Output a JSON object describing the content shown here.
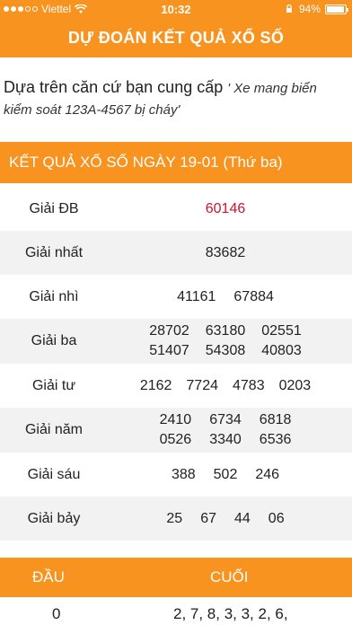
{
  "status_bar": {
    "carrier": "Viettel",
    "time": "10:32",
    "battery_text": "94%",
    "battery_level": 0.94
  },
  "nav": {
    "title": "DỰ ĐOÁN KẾT QUẢ XỔ SỐ"
  },
  "intro": {
    "text": "Dựa trên căn cứ bạn cung cấp",
    "quote": "' Xe mang biển kiểm soát 123A-4567 bị cháy'"
  },
  "result_header": {
    "title": "KẾT QUẢ XỔ SỐ NGÀY 19-01 (Thứ ba)"
  },
  "prizes": [
    {
      "name": "Giải ĐB",
      "lines": [
        [
          "60146"
        ]
      ]
    },
    {
      "name": "Giải nhất",
      "lines": [
        [
          "83682"
        ]
      ]
    },
    {
      "name": "Giải nhì",
      "lines": [
        [
          "41161",
          "67884"
        ]
      ]
    },
    {
      "name": "Giải ba",
      "lines": [
        [
          "28702",
          "63180",
          "02551"
        ],
        [
          "51407",
          "54308",
          "40803"
        ]
      ]
    },
    {
      "name": "Giải tư",
      "lines": [
        [
          "2162",
          "7724",
          "4783",
          "0203"
        ]
      ]
    },
    {
      "name": "Giải năm",
      "lines": [
        [
          "2410",
          "6734",
          "6818"
        ],
        [
          "0526",
          "3340",
          "6536"
        ]
      ]
    },
    {
      "name": "Giải sáu",
      "lines": [
        [
          "388",
          "502",
          "246"
        ]
      ]
    },
    {
      "name": "Giải bảy",
      "lines": [
        [
          "25",
          "67",
          "44",
          "06"
        ]
      ]
    }
  ],
  "dau_cuoi": {
    "dau_label": "ĐẦU",
    "cuoi_label": "CUỐI",
    "rows": [
      {
        "dau": "0",
        "cuoi": "2, 7, 8, 3, 3, 2, 6,"
      }
    ]
  },
  "colors": {
    "accent": "#f7931e",
    "special_number": "#d0142c",
    "alt_row": "#f2f2f2"
  }
}
